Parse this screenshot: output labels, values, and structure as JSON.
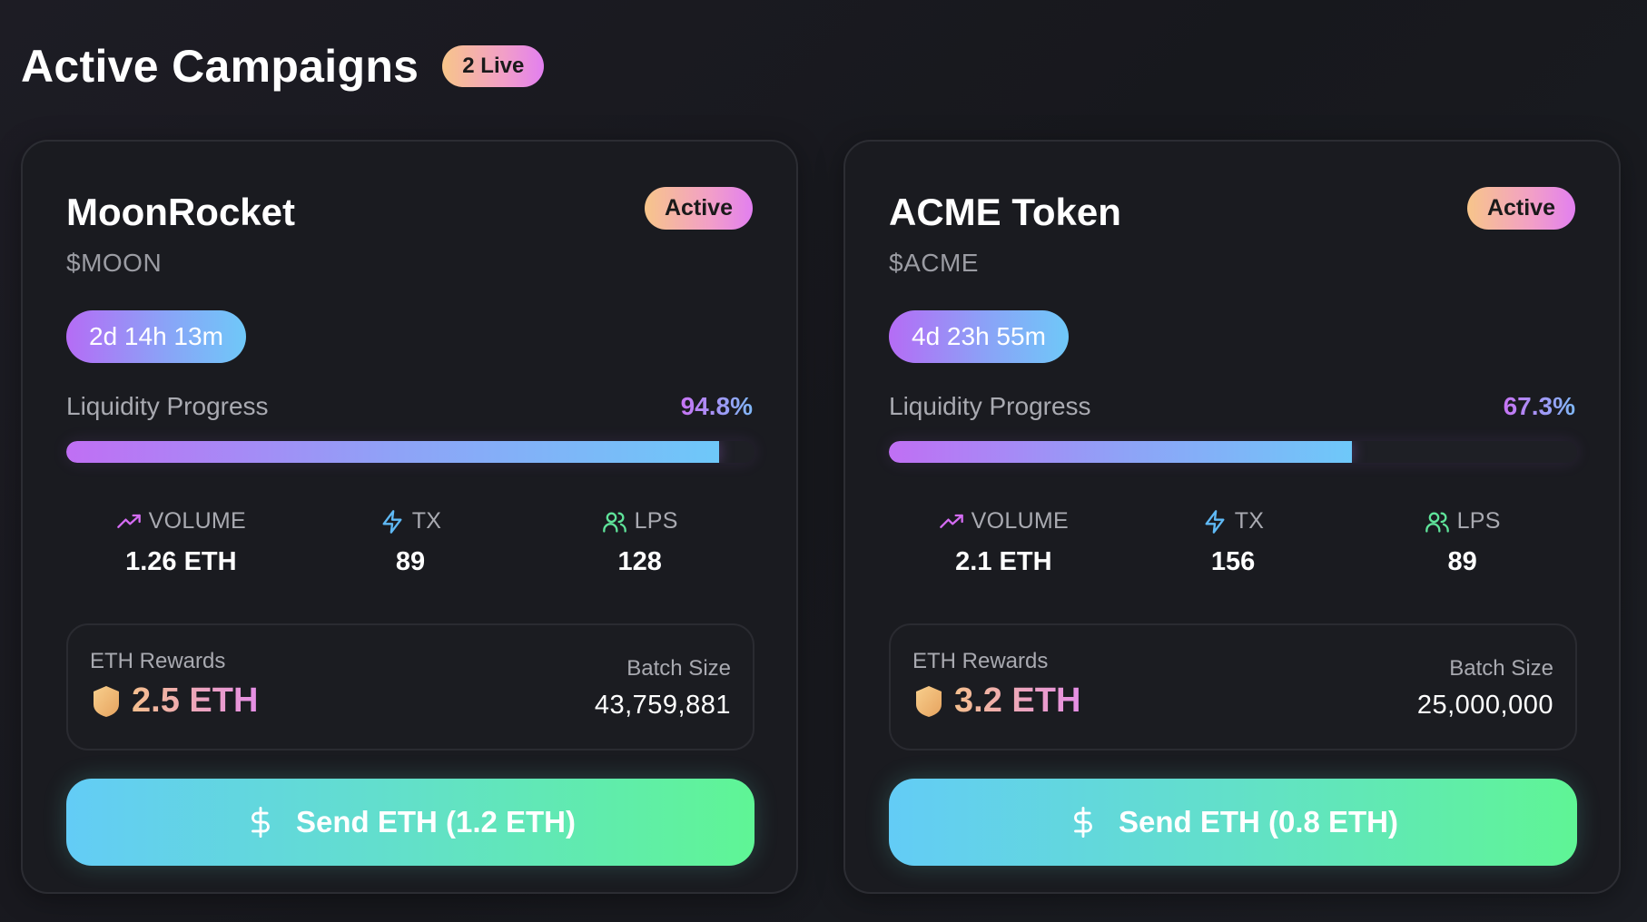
{
  "header": {
    "title": "Active Campaigns",
    "live_badge": "2 Live"
  },
  "campaigns": [
    {
      "name": "MoonRocket",
      "symbol": "$MOON",
      "status": "Active",
      "timer": "2d 14h 13m",
      "progress_label": "Liquidity Progress",
      "progress_text": "94.8%",
      "progress_percent": 94.8,
      "stats": [
        {
          "icon": "trending-up-icon",
          "label": "VOLUME",
          "value": "1.26 ETH"
        },
        {
          "icon": "lightning-icon",
          "label": "TX",
          "value": "89"
        },
        {
          "icon": "users-icon",
          "label": "LPS",
          "value": "128"
        }
      ],
      "rewards_label": "ETH Rewards",
      "rewards_value": "2.5 ETH",
      "batch_label": "Batch Size",
      "batch_value": "43,759,881",
      "send_label": "Send ETH (1.2 ETH)"
    },
    {
      "name": "ACME Token",
      "symbol": "$ACME",
      "status": "Active",
      "timer": "4d 23h 55m",
      "progress_label": "Liquidity Progress",
      "progress_text": "67.3%",
      "progress_percent": 67.3,
      "stats": [
        {
          "icon": "trending-up-icon",
          "label": "VOLUME",
          "value": "2.1 ETH"
        },
        {
          "icon": "lightning-icon",
          "label": "TX",
          "value": "156"
        },
        {
          "icon": "users-icon",
          "label": "LPS",
          "value": "89"
        }
      ],
      "rewards_label": "ETH Rewards",
      "rewards_value": "3.2 ETH",
      "batch_label": "Batch Size",
      "batch_value": "25,000,000",
      "send_label": "Send ETH (0.8 ETH)"
    }
  ],
  "colors": {
    "accent_purple": "#c06ff4",
    "accent_blue": "#6ec8f9",
    "accent_green": "#5ff595",
    "badge_gradient_start": "#f7c58a",
    "badge_gradient_end": "#e27ff0"
  }
}
